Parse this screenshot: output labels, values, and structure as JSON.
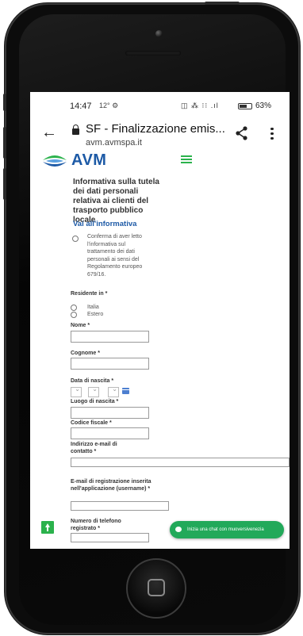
{
  "status_bar": {
    "time": "14:47",
    "extra": "12° ⚙",
    "icons": "◫ ⁂ ⁝⁝ .ıl",
    "battery_level": 0.63,
    "battery_pct": "63%"
  },
  "browser": {
    "title": "SF - Finalizzazione emis...",
    "url": "avm.avmspa.it"
  },
  "site": {
    "brand": "AVM",
    "colors": {
      "brand_blue": "#1d5aa6",
      "brand_green": "#2bb24c",
      "chat_green": "#22a95a"
    }
  },
  "privacy": {
    "title": "Informativa sulla tutela dei dati personali relativa ai clienti del trasporto pubblico locale",
    "link": "Vai all'informativa",
    "consent": "Conferma di aver letto l'informativa sul trattamento dei dati personali ai sensi del Regolamento europeo 679/16."
  },
  "form": {
    "residente_label": "Residente in *",
    "residente_options": [
      "Italia",
      "Estero"
    ],
    "nome_label": "Nome *",
    "cognome_label": "Cognome *",
    "data_nascita_label": "Data di nascita *",
    "luogo_label": "Luogo di nascita *",
    "codice_label": "Codice fiscale *",
    "email_label": "Indirizzo e-mail di contatto *",
    "email_reg_label": "E-mail di registrazione inserita nell'applicazione (username) *",
    "telefono_label": "Numero di telefono registrato *"
  },
  "chat": {
    "label": "Inizia una chat con muoversivenezia"
  }
}
